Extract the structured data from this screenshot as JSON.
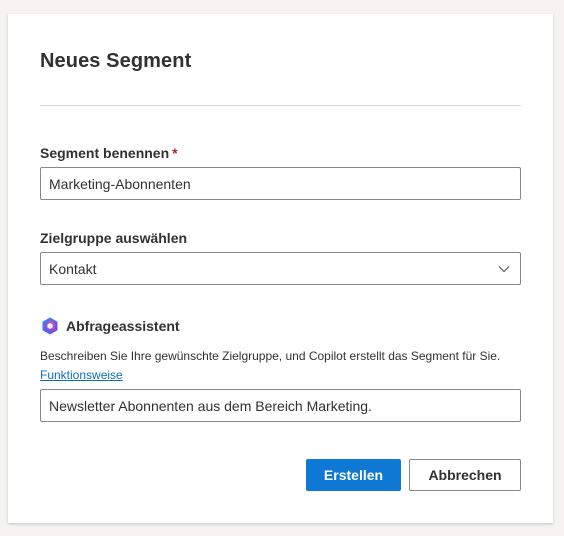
{
  "dialog": {
    "title": "Neues Segment"
  },
  "segment_name": {
    "label": "Segment benennen",
    "required_mark": "*",
    "value": "Marketing-Abonnenten"
  },
  "audience": {
    "label": "Zielgruppe auswählen",
    "selected": "Kontakt"
  },
  "query_assistant": {
    "icon": "copilot-icon",
    "label": "Abfrageassistent",
    "description": "Beschreiben Sie Ihre gewünschte Zielgruppe, und Copilot erstellt das Segment für Sie.",
    "link_label": "Funktionsweise",
    "value": "Newsletter Abonnenten aus dem Bereich Marketing."
  },
  "actions": {
    "create_label": "Erstellen",
    "cancel_label": "Abbrechen"
  },
  "colors": {
    "primary": "#0f78d4",
    "required": "#a4262c",
    "link": "#0f6cbd"
  }
}
